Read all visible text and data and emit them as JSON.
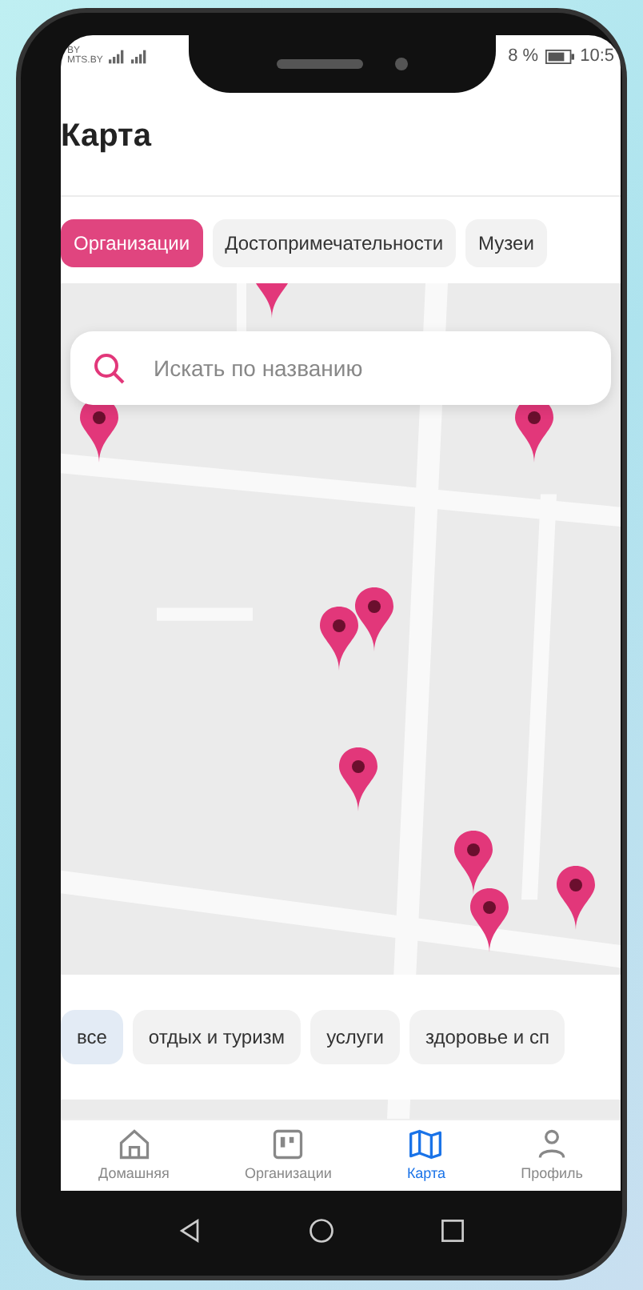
{
  "status_bar": {
    "carrier_top": "BY",
    "carrier": "MTS.BY",
    "battery": "8 %",
    "time": "10:5"
  },
  "title": "Карта",
  "tabs": [
    {
      "label": "Организации",
      "selected": true
    },
    {
      "label": "Достопримечательности",
      "selected": false
    },
    {
      "label": "Музеи",
      "selected": false
    }
  ],
  "search": {
    "placeholder": "Искать по названию"
  },
  "categories": [
    {
      "label": "все",
      "selected": true
    },
    {
      "label": "отдых и туризм",
      "selected": false
    },
    {
      "label": "услуги",
      "selected": false
    },
    {
      "label": "здоровье и сп",
      "selected": false
    }
  ],
  "bottom_nav": [
    {
      "kind": "home",
      "label": "Домашняя",
      "selected": false
    },
    {
      "kind": "organizations",
      "label": "Организации",
      "selected": false
    },
    {
      "kind": "map",
      "label": "Карта",
      "selected": true
    },
    {
      "kind": "profile",
      "label": "Профиль",
      "selected": false
    }
  ]
}
